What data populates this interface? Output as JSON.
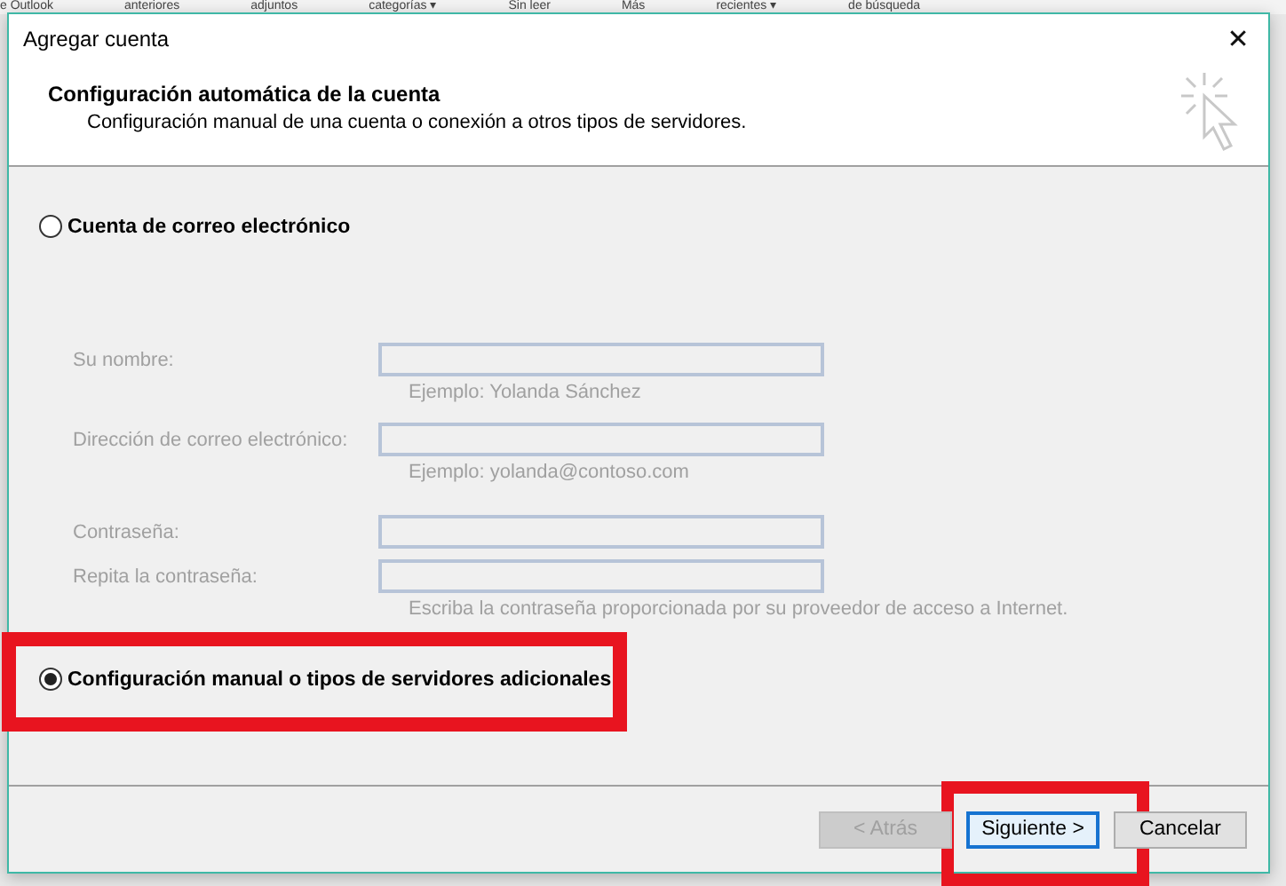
{
  "background_ribbon": [
    "e Outlook",
    "anteriores",
    "adjuntos",
    "categorías ▾",
    "Sin leer",
    "Más",
    "recientes ▾",
    "de búsqueda"
  ],
  "window": {
    "title": "Agregar cuenta",
    "close": "✕"
  },
  "header": {
    "title": "Configuración automática de la cuenta",
    "subtitle": "Configuración manual de una cuenta o conexión a otros tipos de servidores."
  },
  "options": [
    {
      "label": "Cuenta de correo electrónico",
      "selected": false,
      "highlighted": false
    },
    {
      "label": "Configuración manual o tipos de servidores adicionales",
      "selected": true,
      "highlighted": true
    }
  ],
  "fields": [
    {
      "label": "Su nombre:",
      "hint": "Ejemplo: Yolanda Sánchez",
      "disabled": true
    },
    {
      "label": "Dirección de correo electrónico:",
      "hint": "Ejemplo: yolanda@contoso.com",
      "disabled": true
    },
    {
      "label": "Contraseña:",
      "disabled": true
    },
    {
      "label": "Repita la contraseña:",
      "hint": "Escriba la contraseña proporcionada por su proveedor de acceso a Internet.",
      "disabled": true
    }
  ],
  "buttons": [
    {
      "label": "< Atrás",
      "disabled": true,
      "default": false,
      "highlighted": false
    },
    {
      "label": "Siguiente >",
      "disabled": false,
      "default": true,
      "highlighted": true
    },
    {
      "label": "Cancelar",
      "disabled": false,
      "default": false,
      "highlighted": false
    }
  ]
}
